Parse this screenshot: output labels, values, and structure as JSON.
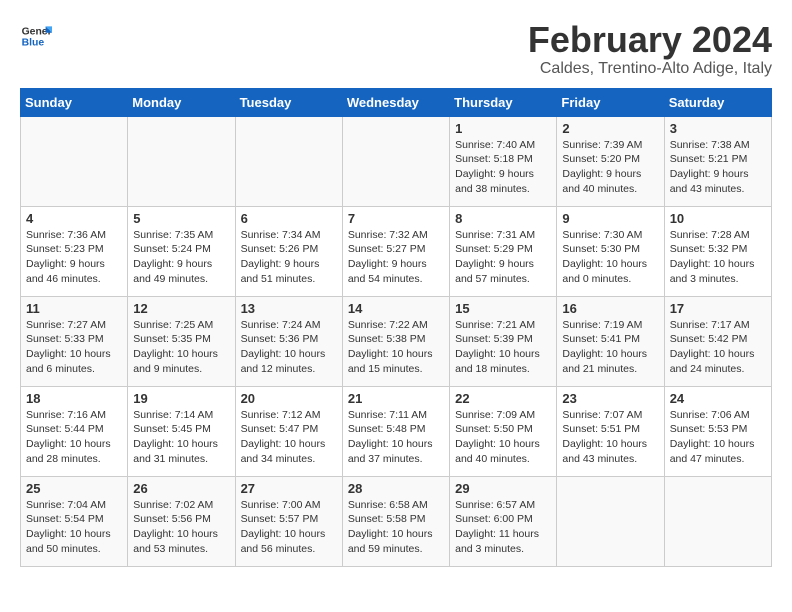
{
  "header": {
    "logo_line1": "General",
    "logo_line2": "Blue",
    "month": "February 2024",
    "location": "Caldes, Trentino-Alto Adige, Italy"
  },
  "weekdays": [
    "Sunday",
    "Monday",
    "Tuesday",
    "Wednesday",
    "Thursday",
    "Friday",
    "Saturday"
  ],
  "weeks": [
    [
      {
        "day": "",
        "info": ""
      },
      {
        "day": "",
        "info": ""
      },
      {
        "day": "",
        "info": ""
      },
      {
        "day": "",
        "info": ""
      },
      {
        "day": "1",
        "info": "Sunrise: 7:40 AM\nSunset: 5:18 PM\nDaylight: 9 hours\nand 38 minutes."
      },
      {
        "day": "2",
        "info": "Sunrise: 7:39 AM\nSunset: 5:20 PM\nDaylight: 9 hours\nand 40 minutes."
      },
      {
        "day": "3",
        "info": "Sunrise: 7:38 AM\nSunset: 5:21 PM\nDaylight: 9 hours\nand 43 minutes."
      }
    ],
    [
      {
        "day": "4",
        "info": "Sunrise: 7:36 AM\nSunset: 5:23 PM\nDaylight: 9 hours\nand 46 minutes."
      },
      {
        "day": "5",
        "info": "Sunrise: 7:35 AM\nSunset: 5:24 PM\nDaylight: 9 hours\nand 49 minutes."
      },
      {
        "day": "6",
        "info": "Sunrise: 7:34 AM\nSunset: 5:26 PM\nDaylight: 9 hours\nand 51 minutes."
      },
      {
        "day": "7",
        "info": "Sunrise: 7:32 AM\nSunset: 5:27 PM\nDaylight: 9 hours\nand 54 minutes."
      },
      {
        "day": "8",
        "info": "Sunrise: 7:31 AM\nSunset: 5:29 PM\nDaylight: 9 hours\nand 57 minutes."
      },
      {
        "day": "9",
        "info": "Sunrise: 7:30 AM\nSunset: 5:30 PM\nDaylight: 10 hours\nand 0 minutes."
      },
      {
        "day": "10",
        "info": "Sunrise: 7:28 AM\nSunset: 5:32 PM\nDaylight: 10 hours\nand 3 minutes."
      }
    ],
    [
      {
        "day": "11",
        "info": "Sunrise: 7:27 AM\nSunset: 5:33 PM\nDaylight: 10 hours\nand 6 minutes."
      },
      {
        "day": "12",
        "info": "Sunrise: 7:25 AM\nSunset: 5:35 PM\nDaylight: 10 hours\nand 9 minutes."
      },
      {
        "day": "13",
        "info": "Sunrise: 7:24 AM\nSunset: 5:36 PM\nDaylight: 10 hours\nand 12 minutes."
      },
      {
        "day": "14",
        "info": "Sunrise: 7:22 AM\nSunset: 5:38 PM\nDaylight: 10 hours\nand 15 minutes."
      },
      {
        "day": "15",
        "info": "Sunrise: 7:21 AM\nSunset: 5:39 PM\nDaylight: 10 hours\nand 18 minutes."
      },
      {
        "day": "16",
        "info": "Sunrise: 7:19 AM\nSunset: 5:41 PM\nDaylight: 10 hours\nand 21 minutes."
      },
      {
        "day": "17",
        "info": "Sunrise: 7:17 AM\nSunset: 5:42 PM\nDaylight: 10 hours\nand 24 minutes."
      }
    ],
    [
      {
        "day": "18",
        "info": "Sunrise: 7:16 AM\nSunset: 5:44 PM\nDaylight: 10 hours\nand 28 minutes."
      },
      {
        "day": "19",
        "info": "Sunrise: 7:14 AM\nSunset: 5:45 PM\nDaylight: 10 hours\nand 31 minutes."
      },
      {
        "day": "20",
        "info": "Sunrise: 7:12 AM\nSunset: 5:47 PM\nDaylight: 10 hours\nand 34 minutes."
      },
      {
        "day": "21",
        "info": "Sunrise: 7:11 AM\nSunset: 5:48 PM\nDaylight: 10 hours\nand 37 minutes."
      },
      {
        "day": "22",
        "info": "Sunrise: 7:09 AM\nSunset: 5:50 PM\nDaylight: 10 hours\nand 40 minutes."
      },
      {
        "day": "23",
        "info": "Sunrise: 7:07 AM\nSunset: 5:51 PM\nDaylight: 10 hours\nand 43 minutes."
      },
      {
        "day": "24",
        "info": "Sunrise: 7:06 AM\nSunset: 5:53 PM\nDaylight: 10 hours\nand 47 minutes."
      }
    ],
    [
      {
        "day": "25",
        "info": "Sunrise: 7:04 AM\nSunset: 5:54 PM\nDaylight: 10 hours\nand 50 minutes."
      },
      {
        "day": "26",
        "info": "Sunrise: 7:02 AM\nSunset: 5:56 PM\nDaylight: 10 hours\nand 53 minutes."
      },
      {
        "day": "27",
        "info": "Sunrise: 7:00 AM\nSunset: 5:57 PM\nDaylight: 10 hours\nand 56 minutes."
      },
      {
        "day": "28",
        "info": "Sunrise: 6:58 AM\nSunset: 5:58 PM\nDaylight: 10 hours\nand 59 minutes."
      },
      {
        "day": "29",
        "info": "Sunrise: 6:57 AM\nSunset: 6:00 PM\nDaylight: 11 hours\nand 3 minutes."
      },
      {
        "day": "",
        "info": ""
      },
      {
        "day": "",
        "info": ""
      }
    ]
  ]
}
